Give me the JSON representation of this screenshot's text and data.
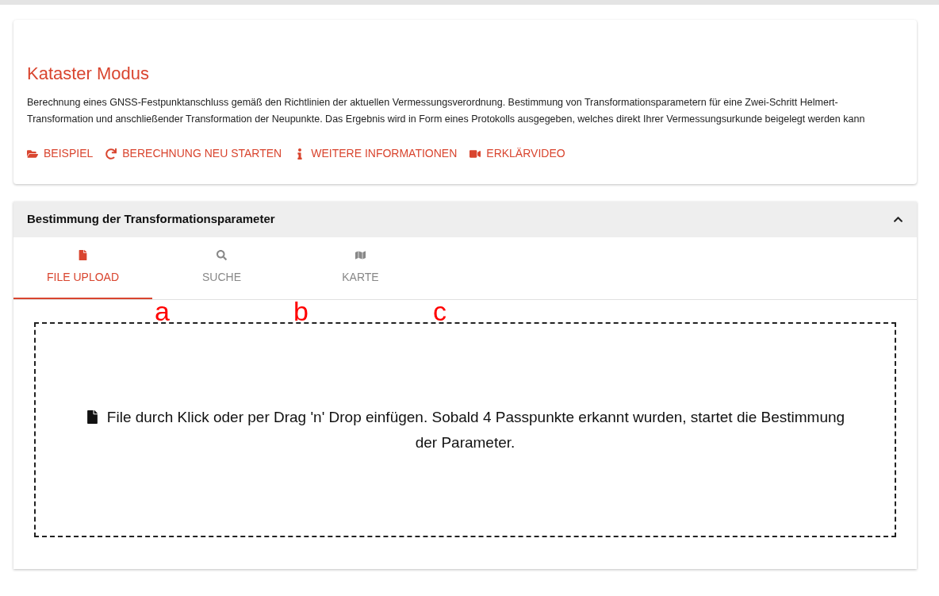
{
  "mode_card": {
    "title": "Kataster Modus",
    "description": "Berechnung eines GNSS-Festpunktanschluss gemäß den Richtlinien der aktuellen Vermessungsverordnung. Bestimmung von Transformationsparametern für eine Zwei-Schritt Helmert-Transformation und anschließender Transformation der Neupunkte. Das Ergebnis wird in Form eines Protokolls ausgegeben, welches direkt Ihrer Vermessungsurkunde beigelegt werden kann",
    "actions": [
      {
        "kind": "folder",
        "label": "BEISPIEL"
      },
      {
        "kind": "restart",
        "label": "BERECHNUNG NEU STARTEN"
      },
      {
        "kind": "info",
        "label": "WEITERE INFORMATIONEN"
      },
      {
        "kind": "video",
        "label": "ERKLÄRVIDEO"
      }
    ]
  },
  "panel": {
    "title": "Bestimmung der Transformationsparameter",
    "expanded": true,
    "tabs": [
      {
        "kind": "file",
        "label": "FILE UPLOAD",
        "selected": true,
        "annotation": "a"
      },
      {
        "kind": "search",
        "label": "SUCHE",
        "selected": false,
        "annotation": "b"
      },
      {
        "kind": "map",
        "label": "KARTE",
        "selected": false,
        "annotation": "c"
      }
    ],
    "dropzone": {
      "text": "File durch Klick oder per Drag 'n' Drop einfügen. Sobald 4 Passpunkte erkannt wurden, startet die Bestimmung der Parameter."
    }
  }
}
